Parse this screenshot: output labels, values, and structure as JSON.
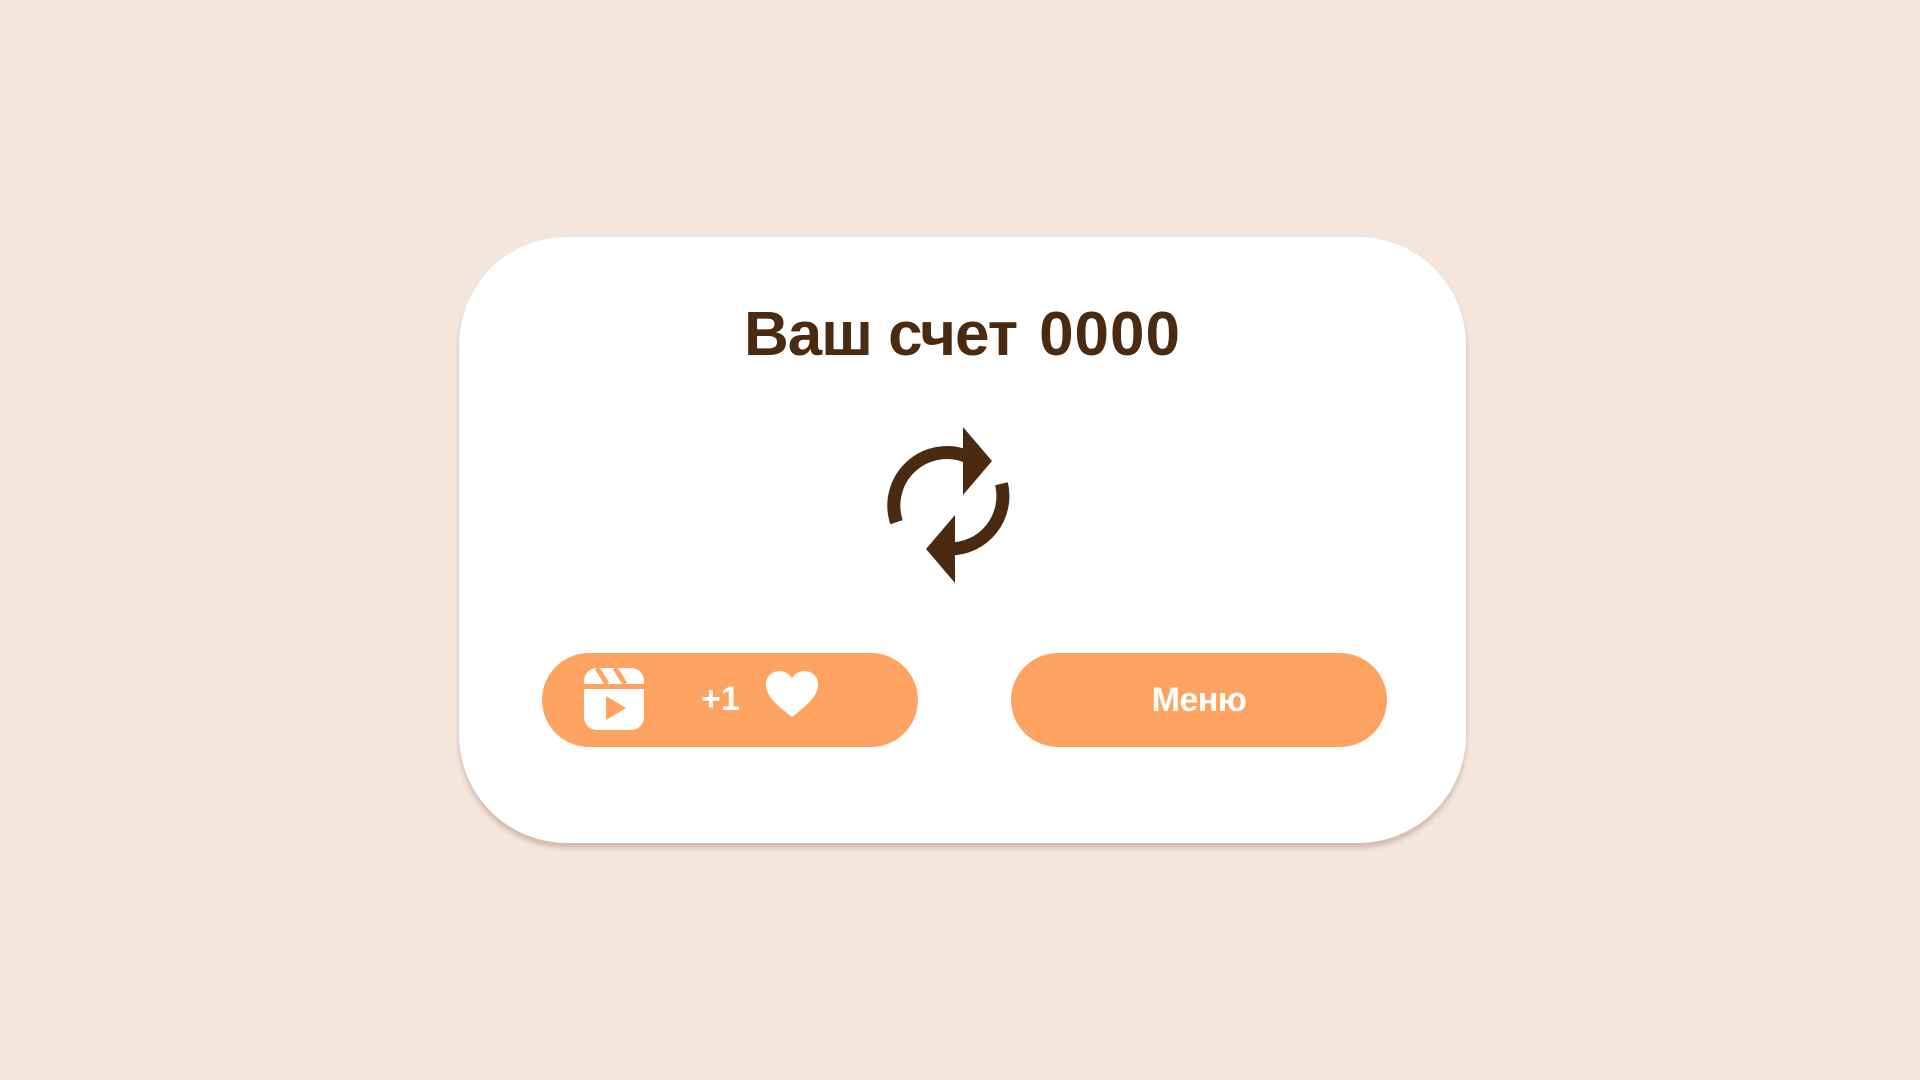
{
  "dialog": {
    "score_label": "Ваш счет",
    "score_value": "0000"
  },
  "icons": {
    "restart": "refresh-icon",
    "ad": "video-reel-icon",
    "heart": "heart-icon"
  },
  "buttons": {
    "reward_label": "+1",
    "menu_label": "Меню"
  },
  "colors": {
    "background": "#F3E6DD",
    "card": "#FFFFFF",
    "text_dark": "#4A2A10",
    "accent": "#FFA362",
    "button_text": "#FFFFFF"
  }
}
